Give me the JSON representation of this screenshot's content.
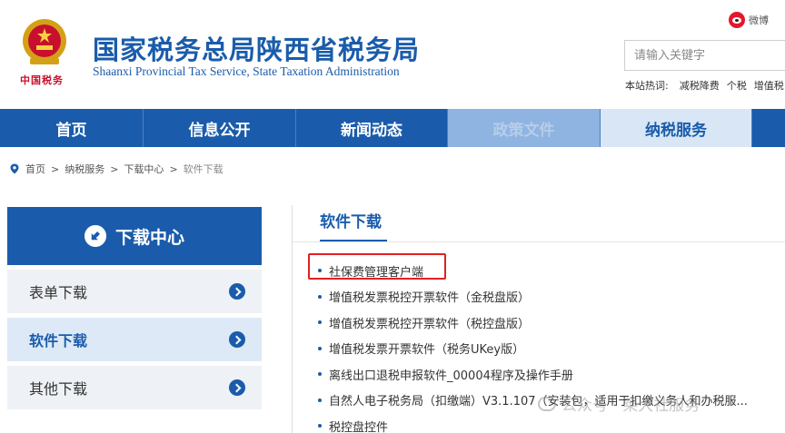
{
  "header": {
    "title_cn": "国家税务总局陕西省税务局",
    "title_en": "Shaanxi Provincial Tax Service, State Taxation Administration",
    "brand_tag": "中国税务",
    "weibo_label": "微博",
    "search_placeholder": "请输入关键字",
    "hot_label": "本站热词:",
    "hot_words": [
      "减税降费",
      "个税",
      "增值税"
    ]
  },
  "nav": {
    "items": [
      "首页",
      "信息公开",
      "新闻动态",
      "政策文件",
      "纳税服务"
    ]
  },
  "breadcrumb": {
    "items": [
      "首页",
      "纳税服务",
      "下载中心"
    ],
    "separator": ">",
    "current": "软件下载"
  },
  "sidebar": {
    "title": "下载中心",
    "items": [
      "表单下载",
      "软件下载",
      "其他下载"
    ]
  },
  "main": {
    "title": "软件下载",
    "list": [
      "社保费管理客户端",
      "增值税发票税控开票软件（金税盘版）",
      "增值税发票税控开票软件（税控盘版）",
      "增值税发票开票软件（税务UKey版）",
      "离线出口退税申报软件_00004程序及操作手册",
      "自然人电子税务局（扣缴端）V3.1.107（安装包，适用于扣缴义务人和办税服...",
      "税控盘控件"
    ]
  },
  "watermark": "公众号 · 莱大社服务",
  "colors": {
    "primary": "#1a5cab",
    "highlight": "#e02020",
    "weibo": "#e6162d"
  }
}
